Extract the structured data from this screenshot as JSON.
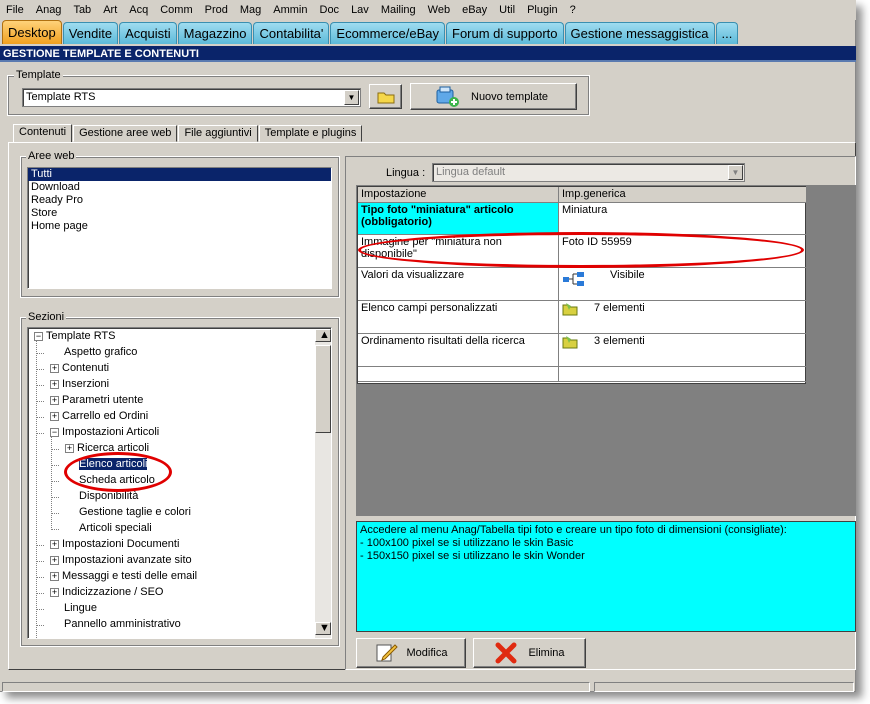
{
  "menu": [
    "File",
    "Anag",
    "Tab",
    "Art",
    "Acq",
    "Comm",
    "Prod",
    "Mag",
    "Ammin",
    "Doc",
    "Lav",
    "Mailing",
    "Web",
    "eBay",
    "Util",
    "Plugin",
    "?"
  ],
  "tabs": [
    "Desktop",
    "Vendite",
    "Acquisti",
    "Magazzino",
    "Contabilita'",
    "Ecommerce/eBay",
    "Forum di supporto",
    "Gestione messaggistica",
    "..."
  ],
  "window_title": "GESTIONE TEMPLATE E CONTENUTI",
  "template": {
    "legend": "Template",
    "value": "Template RTS",
    "new_button": "Nuovo template"
  },
  "subtabs": [
    "Contenuti",
    "Gestione aree web",
    "File aggiuntivi",
    "Template e plugins"
  ],
  "aree_web": {
    "legend": "Aree web",
    "items": [
      "Tutti",
      "Download",
      "Ready Pro",
      "Store",
      "Home page"
    ]
  },
  "sezioni": {
    "legend": "Sezioni",
    "root": "Template RTS",
    "items": [
      {
        "label": "Aspetto grafico",
        "pm": ""
      },
      {
        "label": "Contenuti",
        "pm": "+"
      },
      {
        "label": "Inserzioni",
        "pm": "+"
      },
      {
        "label": "Parametri utente",
        "pm": "+"
      },
      {
        "label": "Carrello ed Ordini",
        "pm": "+"
      },
      {
        "label": "Impostazioni Articoli",
        "pm": "-"
      },
      {
        "label": "Ricerca articoli",
        "pm": "+"
      },
      {
        "label": "Elenco articoli",
        "pm": ""
      },
      {
        "label": "Scheda articolo",
        "pm": ""
      },
      {
        "label": "Disponibilità",
        "pm": ""
      },
      {
        "label": "Gestione taglie e colori",
        "pm": ""
      },
      {
        "label": "Articoli speciali",
        "pm": ""
      },
      {
        "label": "Impostazioni Documenti",
        "pm": "+"
      },
      {
        "label": "Impostazioni avanzate sito",
        "pm": "+"
      },
      {
        "label": "Messaggi e testi delle email",
        "pm": "+"
      },
      {
        "label": "Indicizzazione / SEO",
        "pm": "+"
      },
      {
        "label": "Lingue",
        "pm": ""
      },
      {
        "label": "Pannello amministrativo",
        "pm": ""
      }
    ]
  },
  "lingua": {
    "label": "Lingua :",
    "value": "Lingua default"
  },
  "grid": {
    "headers": [
      "Impostazione",
      "Imp.generica"
    ],
    "rows": [
      {
        "name": "Tipo foto \"miniatura\" articolo (obbligatorio)",
        "value": "Miniatura",
        "bold": true,
        "icon": ""
      },
      {
        "name": "Immagine per \"miniatura non disponibile\"",
        "value": "Foto ID 55959",
        "bold": false,
        "icon": ""
      },
      {
        "name": "Valori da visualizzare",
        "value": "Visibile",
        "bold": false,
        "icon": "tree-icon"
      },
      {
        "name": "Elenco campi personalizzati",
        "value": "7 elementi",
        "bold": false,
        "icon": "folder-icon"
      },
      {
        "name": "Ordinamento risultati della ricerca",
        "value": "3 elementi",
        "bold": false,
        "icon": "folder-icon"
      }
    ]
  },
  "hint_lines": [
    "Accedere al menu Anag/Tabella tipi foto e creare un tipo foto di dimensioni (consigliate):",
    "- 100x100 pixel se si utilizzano le skin Basic",
    "- 150x150 pixel se si utilizzano le skin Wonder"
  ],
  "buttons": {
    "modifica": "Modifica",
    "elimina": "Elimina"
  },
  "colors": {
    "accent_tab": "#f0a020",
    "tab": "#5cbad9",
    "title_bar": "#0a246a",
    "hint_bg": "#00ffff",
    "annotation": "#e00000"
  }
}
